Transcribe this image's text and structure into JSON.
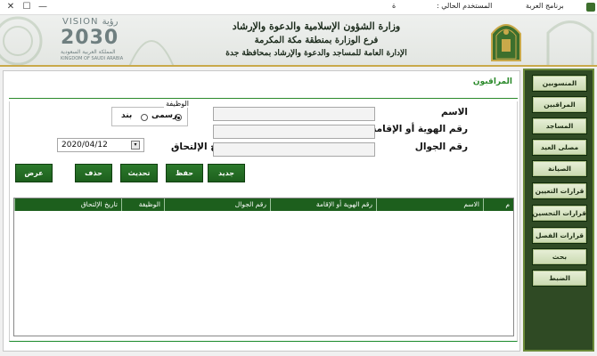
{
  "titlebar": {
    "app_name": "برنامج العربة",
    "current_user_label": "المستخدم الحالي :",
    "current_user_value": "ة",
    "min_glyph": "—",
    "max_glyph": "☐",
    "close_glyph": "✕"
  },
  "banner": {
    "ministry_line1": "وزارة الشؤون الإسلامية والدعوة والإرشاد",
    "ministry_line2": "فرع الوزارة بمنطقة مكة المكرمة",
    "ministry_line3": "الإدارة العامة للمساجد والدعوة والإرشاد بمحافظة جدة",
    "vision_top": "VISION رؤية",
    "vision_year": "2030",
    "vision_sub_ar": "المملكة العربية السعودية",
    "vision_sub_en": "KINGDOM OF SAUDI ARABIA"
  },
  "sidebar": {
    "items": [
      {
        "label": "المنسوبين"
      },
      {
        "label": "المراقبين"
      },
      {
        "label": "المساجد"
      },
      {
        "label": "مصلى العيد"
      },
      {
        "label": "الصيانة"
      },
      {
        "label": "قرارات التعيين"
      },
      {
        "label": "قرارات التحسين"
      },
      {
        "label": "قرارات الفصل"
      },
      {
        "label": "بحث"
      },
      {
        "label": "الضبط"
      }
    ]
  },
  "main": {
    "tab_title": "المراقبون",
    "form": {
      "name_label": "الاسم",
      "id_label": "رقم الهوية أو الإقامة",
      "mobile_label": "رقم الجوال",
      "join_date_label": "تاريخ الإلتحاق",
      "join_date_value": "2020/04/12",
      "role_legend": "الوظيفة",
      "role_official": "رسمى",
      "role_item": "بند",
      "name_value": "",
      "id_value": "",
      "mobile_value": ""
    },
    "actions": {
      "new": "جديد",
      "save": "حفظ",
      "update": "تحديث",
      "delete": "حذف",
      "show_all": "عرض الكل"
    },
    "grid": {
      "columns": [
        "م",
        "الاسم",
        "رقم الهوية أو الإقامة",
        "رقم الجوال",
        "الوظيفة",
        "تاريخ الإلتحاق"
      ],
      "rows": []
    }
  },
  "colors": {
    "accent_green": "#1d5f1d",
    "sidebar_bg": "#2f4a24",
    "tab_green": "#2b8a2b"
  }
}
